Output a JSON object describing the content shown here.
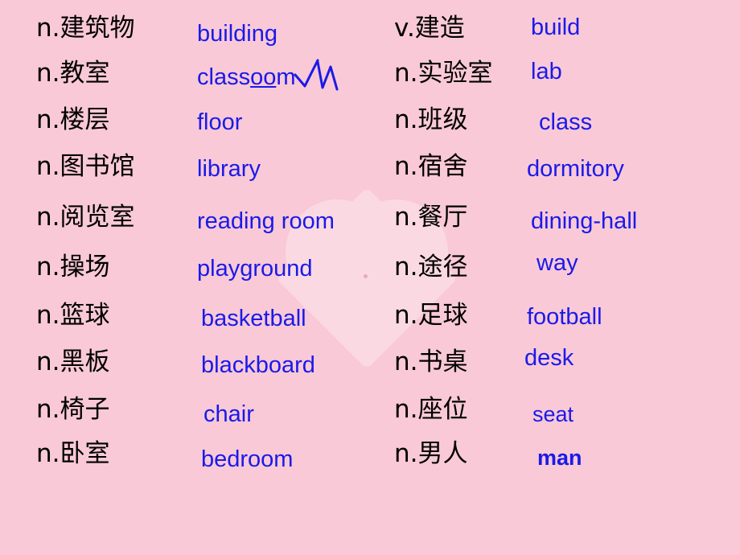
{
  "slide": {
    "background_color": "#f9c9d7",
    "chinese_color": "#000000",
    "english_color": "#1a1ae8",
    "watermark": "heart-shape"
  },
  "columns": [
    {
      "name": "left-column",
      "entries": [
        {
          "chinese": "n.建筑物",
          "english": "building"
        },
        {
          "chinese": "n.教室",
          "english": "classroom",
          "annotation": "checkmark"
        },
        {
          "chinese": "n.楼层",
          "english": "floor"
        },
        {
          "chinese": "n.图书馆",
          "english": "library"
        },
        {
          "chinese": "n.阅览室",
          "english": "reading room"
        },
        {
          "chinese": "n.操场",
          "english": "playground"
        },
        {
          "chinese": "n.篮球",
          "english": "basketball"
        },
        {
          "chinese": "n.黑板",
          "english": "blackboard"
        },
        {
          "chinese": "n.椅子",
          "english": "chair"
        },
        {
          "chinese": "n.卧室",
          "english": "bedroom"
        }
      ]
    },
    {
      "name": "right-column",
      "entries": [
        {
          "chinese": "v.建造",
          "english": "build"
        },
        {
          "chinese": "n.实验室",
          "english": "lab"
        },
        {
          "chinese": "n.班级",
          "english": "class"
        },
        {
          "chinese": "n.宿舍",
          "english": "dormitory"
        },
        {
          "chinese": "n.餐厅",
          "english": "dining-hall"
        },
        {
          "chinese": "n.途径",
          "english": "way"
        },
        {
          "chinese": "n.足球",
          "english": "football"
        },
        {
          "chinese": "n.书桌",
          "english": "desk"
        },
        {
          "chinese": "n.座位",
          "english": "seat"
        },
        {
          "chinese": "n.男人",
          "english": "man"
        }
      ]
    }
  ]
}
